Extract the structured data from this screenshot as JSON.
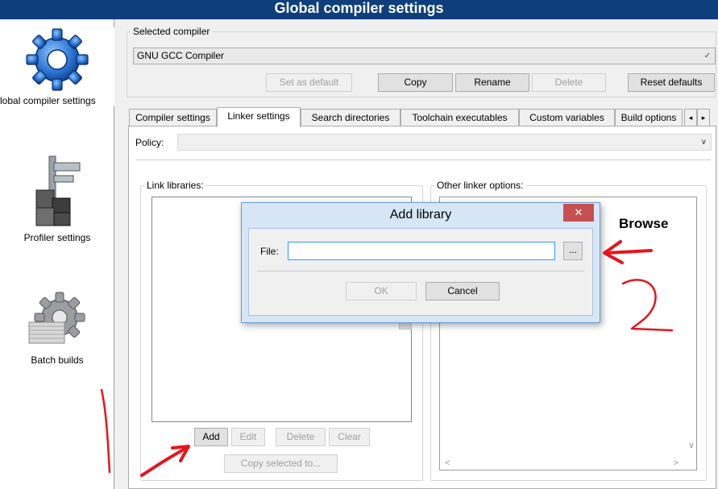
{
  "window": {
    "title": "Global compiler settings"
  },
  "sidebar": {
    "items": [
      {
        "label": "lobal compiler settings",
        "icon": "gear-icon"
      },
      {
        "label": "Profiler settings",
        "icon": "caliper-icon"
      },
      {
        "label": "Batch builds",
        "icon": "batch-gear-icon"
      }
    ]
  },
  "compiler": {
    "group_label": "Selected compiler",
    "selected": "GNU GCC Compiler",
    "buttons": {
      "set_default": "Set as default",
      "copy": "Copy",
      "rename": "Rename",
      "delete": "Delete",
      "reset": "Reset defaults"
    }
  },
  "tabs": [
    "Compiler settings",
    "Linker settings",
    "Search directories",
    "Toolchain executables",
    "Custom variables",
    "Build options"
  ],
  "tab_scroll": {
    "left": "◂",
    "right": "▸"
  },
  "linker": {
    "policy_label": "Policy:",
    "libs_label": "Link libraries:",
    "other_label": "Other linker options:",
    "buttons": {
      "add": "Add",
      "edit": "Edit",
      "delete": "Delete",
      "clear": "Clear",
      "copy_selected": "Copy selected to..."
    }
  },
  "dialog": {
    "title": "Add library",
    "close": "✕",
    "file_label": "File:",
    "file_value": "",
    "browse_button": "...",
    "ok": "OK",
    "cancel": "Cancel"
  },
  "annotation": {
    "browse_text": "Browse"
  },
  "colors": {
    "titlebar": "#0e3f7c",
    "annotation": "#e8141c",
    "dialog_frame": "#d6e6f7"
  }
}
